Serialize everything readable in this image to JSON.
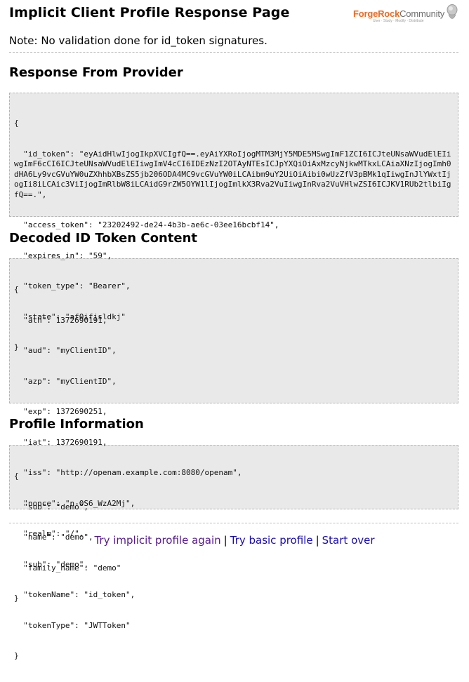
{
  "page_title": "Implicit Client Profile Response Page",
  "logo": {
    "brand": "ForgeRock",
    "suffix": "Community",
    "tagline": "User · Study · Modify · Distribute"
  },
  "note": "Note: No validation done for id_token signatures.",
  "sections": {
    "response": {
      "heading": "Response From Provider",
      "lines": [
        "{",
        "  \"id_token\": \"eyAidHlwIjogIkpXVCIgfQ==.eyAiYXRoIjogMTM3MjY5MDE5MSwgImF1ZCI6ICJteUNsaWVudElEIiwgImF6cCI6ICJteUNsaWVudElEIiwgImV4cCI6IDEzNzI2OTAyNTEsICJpYXQiOiAxMzcyNjkwMTkxLCAiaXNzIjogImh0dHA6Ly9vcGVuYW0uZXhhbXBsZS5jb206ODA4MC9vcGVuYW0iLCAibm9uY2UiOiAibi0wUzZfV3pBMk1qIiwgInJlYWxtIjogIi8iLCAic3ViIjogImRlbW8iLCAidG9rZW5OYW1lIjogImlkX3Rva2VuIiwgInRva2VuVHlwZSI6ICJKV1RUb2tlbiIgfQ==.\",",
        "  \"access_token\": \"23202492-de24-4b3b-ae6c-03ee16bcbf14\",",
        "  \"expires_in\": \"59\",",
        "  \"token_type\": \"Bearer\",",
        "  \"state\": \"af0ifjsldkj\"",
        "}"
      ]
    },
    "decoded": {
      "heading": "Decoded ID Token Content",
      "lines": [
        "{",
        "  \"ath\": 1372690191,",
        "  \"aud\": \"myClientID\",",
        "  \"azp\": \"myClientID\",",
        "  \"exp\": 1372690251,",
        "  \"iat\": 1372690191,",
        "  \"iss\": \"http://openam.example.com:8080/openam\",",
        "  \"nonce\": \"n-0S6_WzA2Mj\",",
        "  \"realm\": \"/\",",
        "  \"sub\": \"demo\",",
        "  \"tokenName\": \"id_token\",",
        "  \"tokenType\": \"JWTToken\"",
        "}"
      ]
    },
    "profile": {
      "heading": "Profile Information",
      "lines": [
        "{",
        "  \"sub\": \"demo\",",
        "  \"name\": \"demo\",",
        "  \"family_name\": \"demo\"",
        "}"
      ]
    }
  },
  "links": {
    "try_implicit": "Try implicit profile again",
    "separator": "|",
    "try_basic": "Try basic profile",
    "start_over": "Start over"
  },
  "colors": {
    "visited_link": "#551a8b",
    "link": "#1a0dab",
    "code_bg": "#e9e9e9",
    "brand_orange": "#ea6a20"
  }
}
